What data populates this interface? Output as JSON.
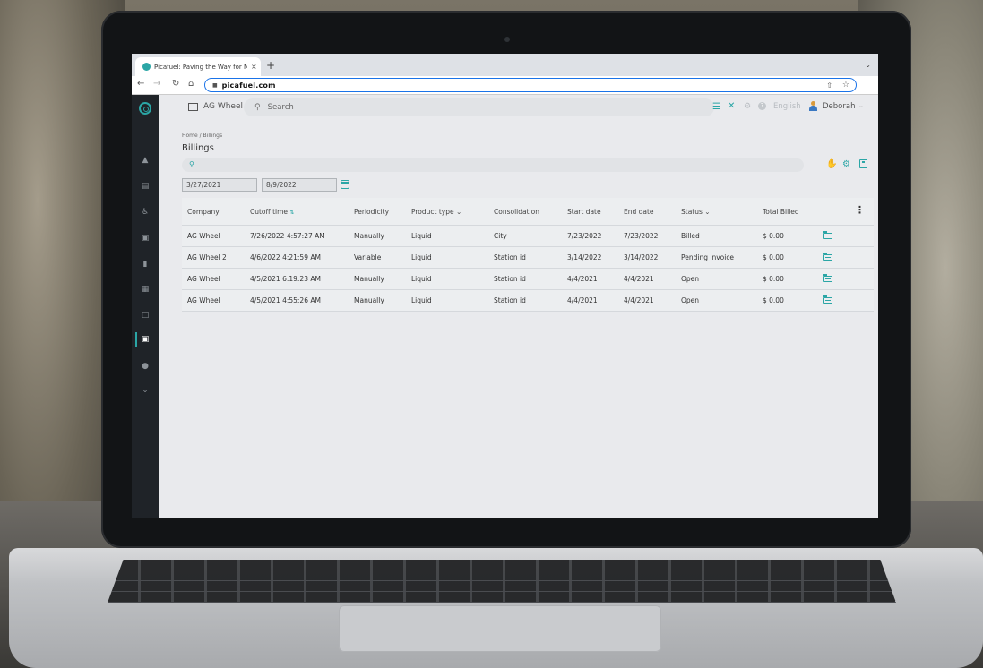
{
  "browser": {
    "tab_title": "Picafuel: Paving the Way for M",
    "tab_close": "×",
    "new_tab": "+",
    "url": "picafuel.com"
  },
  "header": {
    "company": "AG Wheel",
    "search_placeholder": "Search",
    "language": "English",
    "user": "Deborah"
  },
  "page": {
    "breadcrumb": "Home / Billings",
    "title": "Billings"
  },
  "filters": {
    "start_date": "3/27/2021",
    "end_date": "8/9/2022"
  },
  "table": {
    "columns": [
      "Company",
      "Cutoff time",
      "Periodicity",
      "Product type",
      "Consolidation",
      "Start date",
      "End date",
      "Status",
      "Total Billed"
    ],
    "rows": [
      {
        "company": "AG Wheel",
        "cutoff": "7/26/2022 4:57:27 AM",
        "periodicity": "Manually",
        "product": "Liquid",
        "consolidation": "City",
        "start": "7/23/2022",
        "end": "7/23/2022",
        "status": "Billed",
        "total": "$ 0.00"
      },
      {
        "company": "AG Wheel 2",
        "cutoff": "4/6/2022 4:21:59 AM",
        "periodicity": "Variable",
        "product": "Liquid",
        "consolidation": "Station id",
        "start": "3/14/2022",
        "end": "3/14/2022",
        "status": "Pending invoice",
        "total": "$ 0.00"
      },
      {
        "company": "AG Wheel",
        "cutoff": "4/5/2021 6:19:23 AM",
        "periodicity": "Manually",
        "product": "Liquid",
        "consolidation": "Station id",
        "start": "4/4/2021",
        "end": "4/4/2021",
        "status": "Open",
        "total": "$ 0.00"
      },
      {
        "company": "AG Wheel",
        "cutoff": "4/5/2021 4:55:26 AM",
        "periodicity": "Manually",
        "product": "Liquid",
        "consolidation": "Station id",
        "start": "4/4/2021",
        "end": "4/4/2021",
        "status": "Open",
        "total": "$ 0.00"
      }
    ]
  },
  "colors": {
    "accent": "#2ba6a6",
    "sidebar": "#1f2328"
  }
}
